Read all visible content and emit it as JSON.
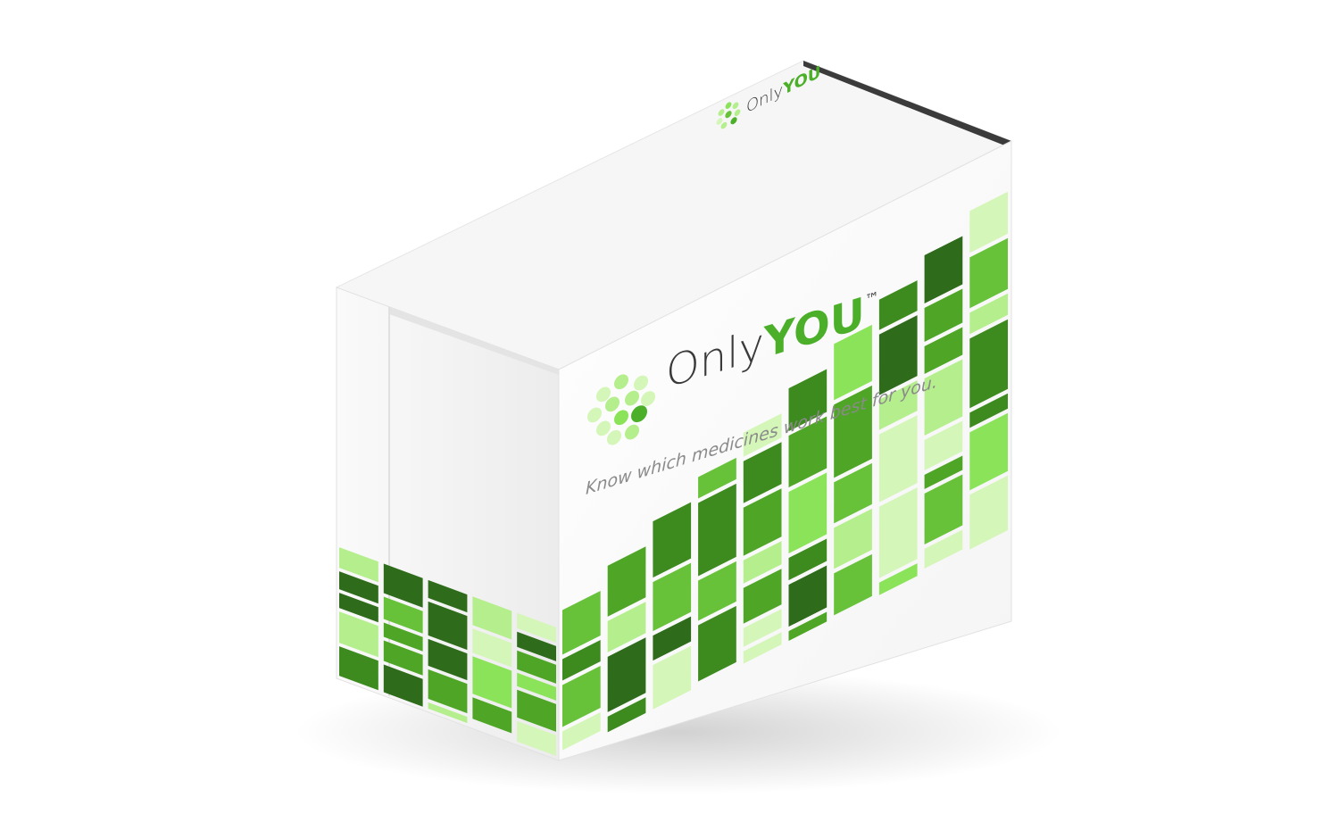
{
  "product": {
    "brand_name_light": "Only",
    "brand_name_bold": "YOU",
    "trademark": "™",
    "tagline": "Know which medicines work best for you."
  },
  "colors": {
    "background": "#ffffff",
    "box_front": "#ffffff",
    "box_top": "#f7f7f7",
    "box_side": "#f1f1f1",
    "brand_text_dark": "#3a3a3a",
    "brand_accent": "#4caf2a",
    "tagline": "#8a8a8a",
    "mosaic_palette": [
      "#2e6b1a",
      "#3d8a1f",
      "#4fa626",
      "#67c23a",
      "#8be35a",
      "#b5ee8c",
      "#d4f6b8",
      "#f3fbec"
    ]
  },
  "icons": {
    "logo": "sphere-dots-logo-icon"
  }
}
